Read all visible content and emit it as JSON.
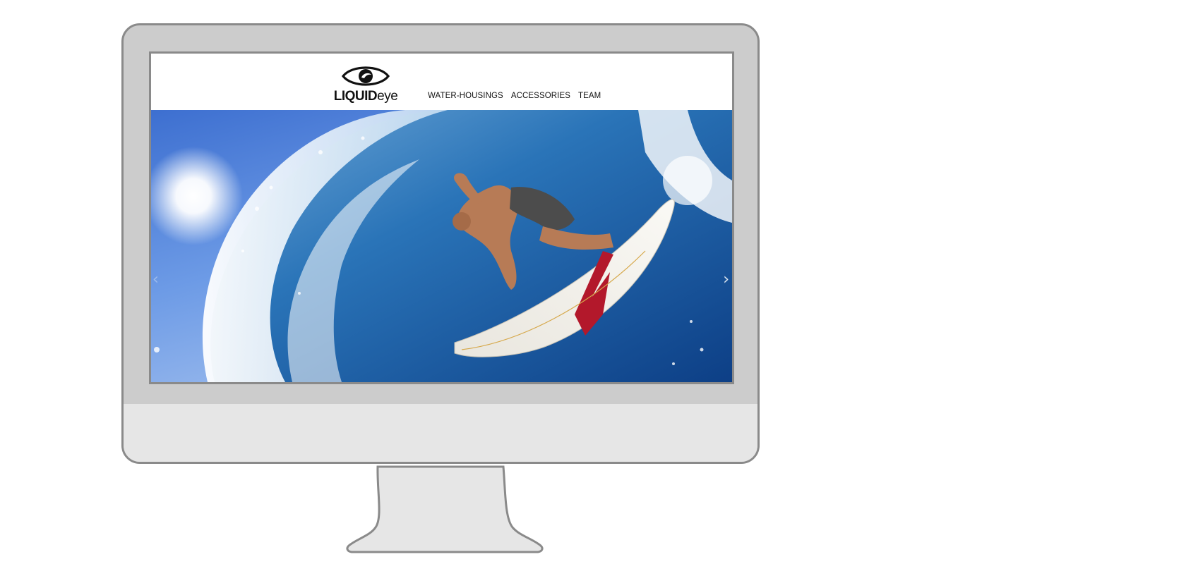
{
  "site": {
    "logo": {
      "bold_part": "LIQUID",
      "light_part": "eye",
      "icon": "eye-icon"
    },
    "nav": [
      {
        "label": "WATER-HOUSINGS"
      },
      {
        "label": "ACCESSORIES"
      },
      {
        "label": "TEAM"
      }
    ]
  },
  "hero": {
    "image": "surfer-wave-photo",
    "prev_icon": "chevron-left-icon",
    "next_icon": "chevron-right-icon",
    "prev_glyph": "‹",
    "next_glyph": "›"
  },
  "colors": {
    "monitor_frame": "#cccccc",
    "monitor_chin": "#e6e6e6",
    "monitor_border": "#8a8a8a",
    "sky_blue": "#4a7fd6",
    "water_blue": "#1f5fa8"
  }
}
